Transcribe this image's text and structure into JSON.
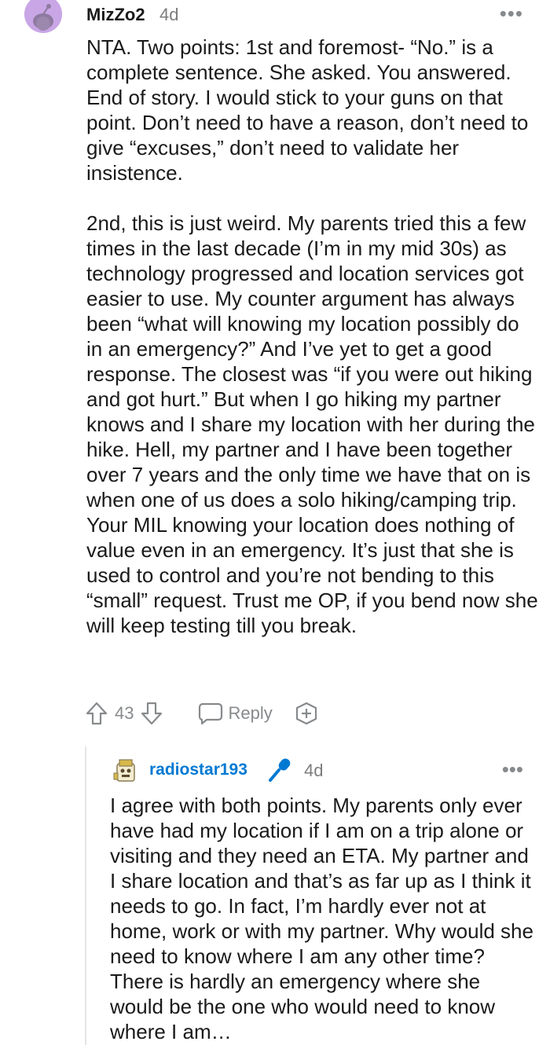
{
  "comment": {
    "username": "MizZo2",
    "age": "4d",
    "paragraphs": [
      "NTA. Two points: 1st and foremost- “No.” is a complete sentence. She asked. You answered. End of story. I would stick to your guns on that point. Don’t need to have a reason, don’t need to give “excuses,” don’t need to validate her insistence.",
      "2nd, this is just weird. My parents tried this a few times in the last decade (I’m in my mid 30s) as technology progressed and location services got easier to use. My counter argument has always been “what will knowing my location possibly do in an emergency?” And I’ve yet to get a good response. The closest was “if you were out hiking and got hurt.” But when I go hiking my partner knows and I share my location with her during the hike. Hell, my partner and I have been together over 7 years and the only time we have that on is when one of us does a solo hiking/camping trip. Your MIL knowing your location does nothing of value even in an emergency. It’s just that she is used to control and you’re not bending to this “small” request. Trust me OP, if you bend now she will keep testing till you break."
    ],
    "vote_count": "43",
    "reply_label": "Reply",
    "avatar_icon": "reddit-snoo-icon",
    "avatar_color": "#c9a6e6"
  },
  "reply": {
    "username": "radiostar193",
    "age": "4d",
    "text": "I agree with both points. My parents only ever have had my location if I am on a trip alone or visiting and they need an ETA. My partner and I share location and that’s as far up as I think it needs to go. In fact, I’m hardly ever not at home, work or with my partner. Why would she need to know where I am any other time? There is hardly an emergency where she would be the one who would need to know where I am…",
    "username_color": "#0079d3",
    "badge_icon": "microphone-icon"
  }
}
